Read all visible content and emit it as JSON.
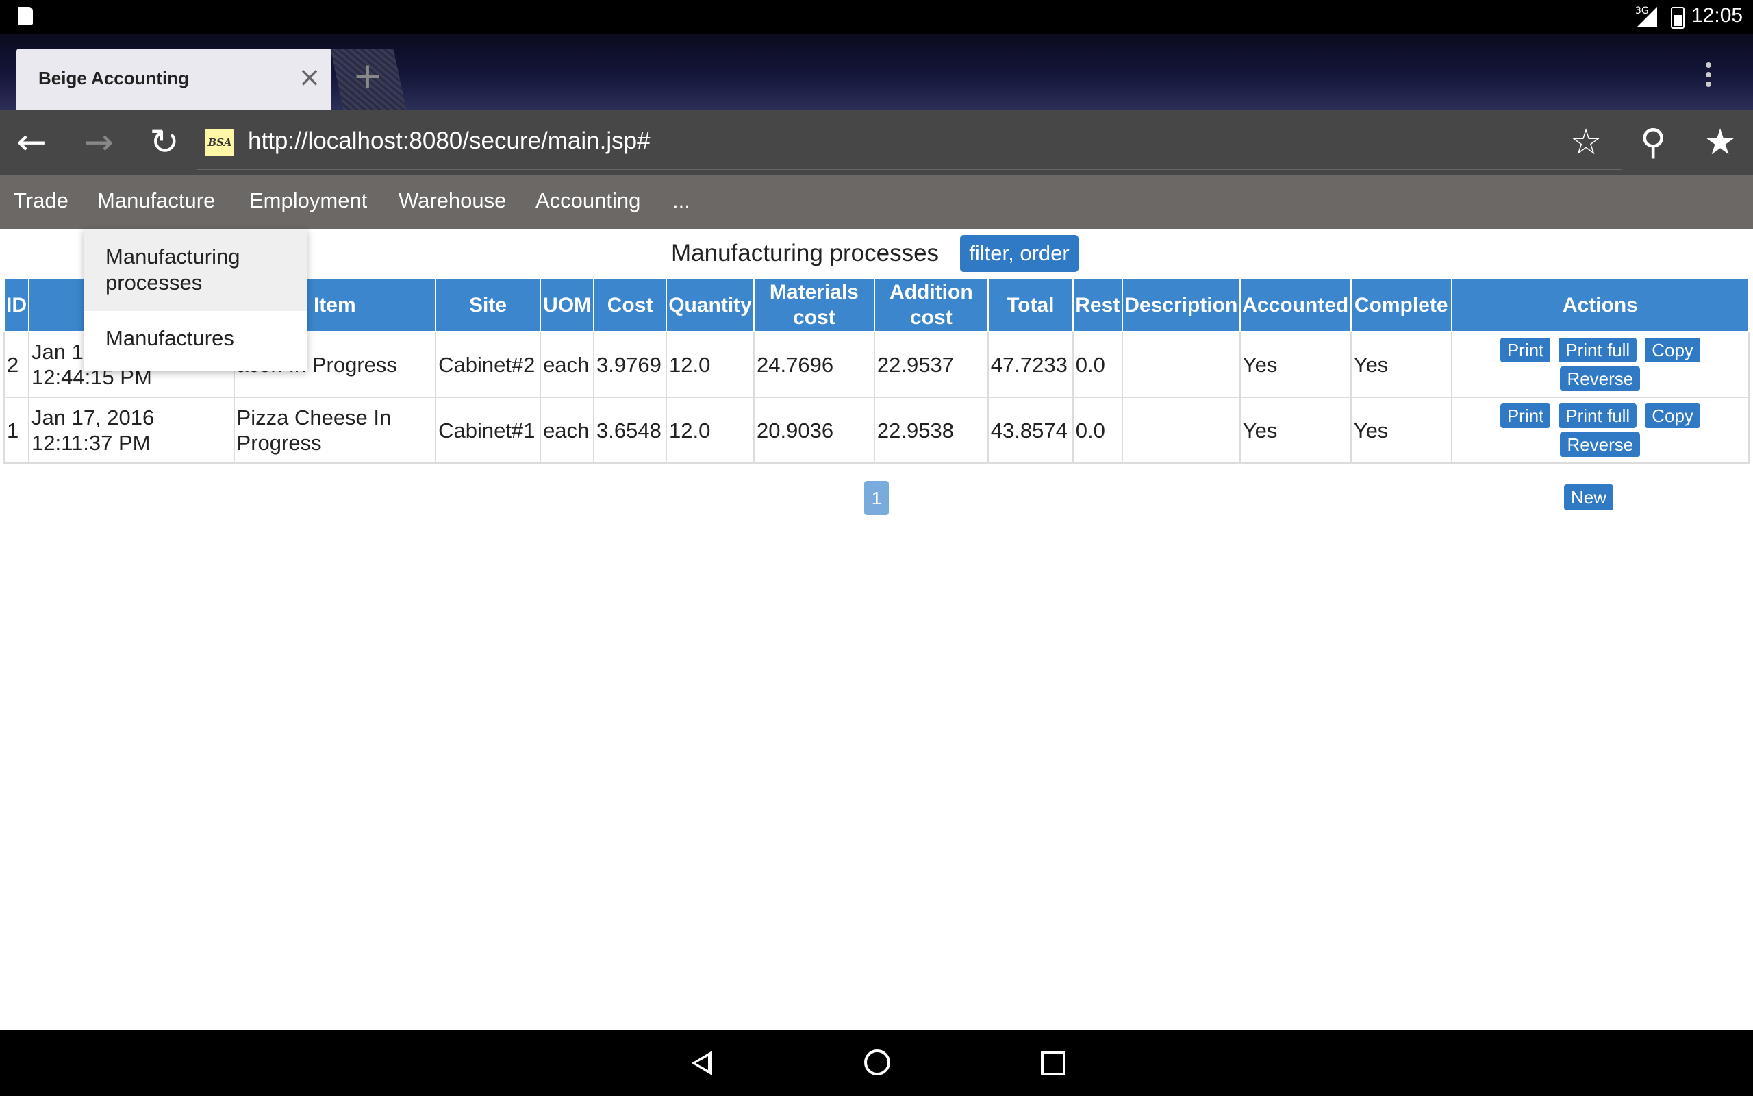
{
  "status_bar": {
    "network": "3G",
    "time": "12:05"
  },
  "browser": {
    "tab_title": "Beige Accounting",
    "favicon_text": "BSA",
    "url": "http://localhost:8080/secure/main.jsp#"
  },
  "nav": {
    "items": [
      "Trade",
      "Manufacture",
      "Employment",
      "Warehouse",
      "Accounting",
      "..."
    ]
  },
  "dropdown": {
    "items": [
      "Manufacturing processes",
      "Manufactures"
    ]
  },
  "page": {
    "title": "Manufacturing processes",
    "filter_label": "filter, order"
  },
  "table": {
    "headers": [
      "ID",
      "",
      "Item",
      "Site",
      "UOM",
      "Cost",
      "Quantity",
      "Materials cost",
      "Addition cost",
      "Total",
      "Rest",
      "Description",
      "Accounted",
      "Complete",
      "Actions"
    ],
    "rows": [
      {
        "id": "2",
        "date": "Jan 1",
        "time": "12:44:15 PM",
        "item": "acon In Progress",
        "site": "Cabinet#2",
        "uom": "each",
        "cost": "3.9769",
        "quantity": "12.0",
        "materials_cost": "24.7696",
        "addition_cost": "22.9537",
        "total": "47.7233",
        "rest": "0.0",
        "description": "",
        "accounted": "Yes",
        "complete": "Yes"
      },
      {
        "id": "1",
        "date": "Jan 17, 2016",
        "time": "12:11:37 PM",
        "item": "Pizza Cheese In Progress",
        "site": "Cabinet#1",
        "uom": "each",
        "cost": "3.6548",
        "quantity": "12.0",
        "materials_cost": "20.9036",
        "addition_cost": "22.9538",
        "total": "43.8574",
        "rest": "0.0",
        "description": "",
        "accounted": "Yes",
        "complete": "Yes"
      }
    ],
    "actions": [
      "Print",
      "Print full",
      "Copy",
      "Reverse"
    ]
  },
  "pagination": {
    "current_page": "1"
  },
  "new_label": "New"
}
